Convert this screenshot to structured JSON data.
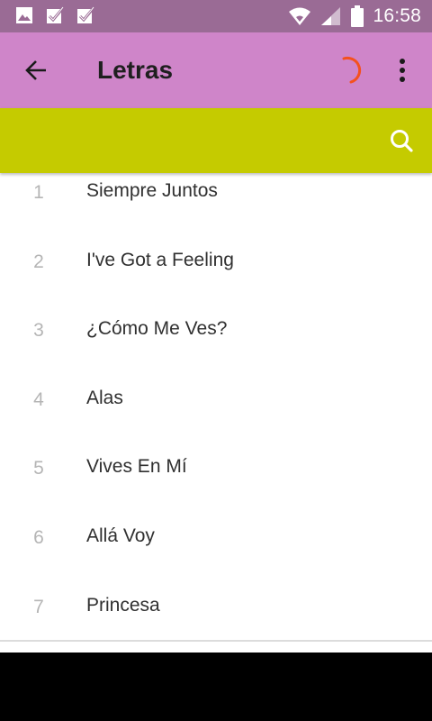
{
  "status_bar": {
    "time": "16:58",
    "left_icons": [
      "image-icon",
      "download-icon",
      "download-icon"
    ],
    "right_icons": [
      "wifi-icon",
      "signal-icon",
      "battery-icon"
    ]
  },
  "app_bar": {
    "title": "Letras",
    "back_icon": "arrow-left-icon",
    "more_icon": "more-vertical-icon",
    "loading": true
  },
  "search": {
    "icon": "search-icon"
  },
  "songs": [
    {
      "number": "1",
      "title": "Siempre Juntos"
    },
    {
      "number": "2",
      "title": "I've Got a Feeling"
    },
    {
      "number": "3",
      "title": "¿Cómo Me Ves?"
    },
    {
      "number": "4",
      "title": "Alas"
    },
    {
      "number": "5",
      "title": "Vives En Mí"
    },
    {
      "number": "6",
      "title": "Allá Voy"
    },
    {
      "number": "7",
      "title": "Princesa"
    }
  ],
  "colors": {
    "status_bar": "#9a6b95",
    "app_bar": "#cf85c9",
    "search_bar": "#c5cb00",
    "spinner": "#f4511e"
  }
}
